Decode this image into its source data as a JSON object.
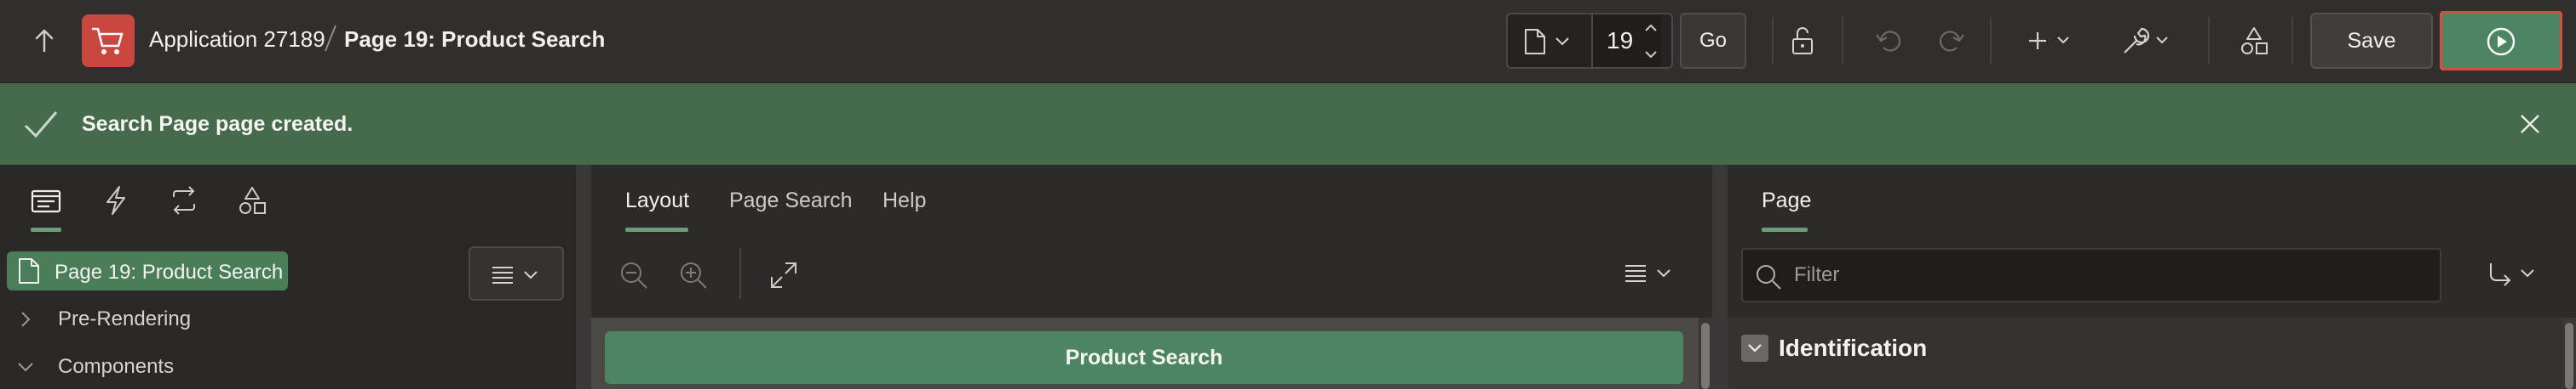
{
  "header": {
    "app_name": "Application 27189",
    "page_name": "Page 19: Product Search",
    "page_number": "19",
    "go_label": "Go",
    "save_label": "Save"
  },
  "message": {
    "text": "Search Page page created."
  },
  "left_pane": {
    "tabs": [
      "rendering-icon",
      "dynamic-actions-icon",
      "processing-icon",
      "shared-components-icon"
    ],
    "tree": {
      "root": "Page 19: Product Search",
      "items": [
        {
          "label": "Pre-Rendering",
          "expanded": false
        },
        {
          "label": "Components",
          "expanded": true
        }
      ]
    }
  },
  "center_pane": {
    "tabs": [
      {
        "label": "Layout",
        "active": true
      },
      {
        "label": "Page Search",
        "active": false
      },
      {
        "label": "Help",
        "active": false
      }
    ],
    "region_label": "Product Search"
  },
  "right_pane": {
    "tab_label": "Page",
    "filter_placeholder": "Filter",
    "group_title": "Identification"
  },
  "colors": {
    "accent_green": "#4d8461",
    "success_bg": "#466a4c",
    "app_icon": "#c9473f",
    "run_outline": "#d64e3d"
  }
}
